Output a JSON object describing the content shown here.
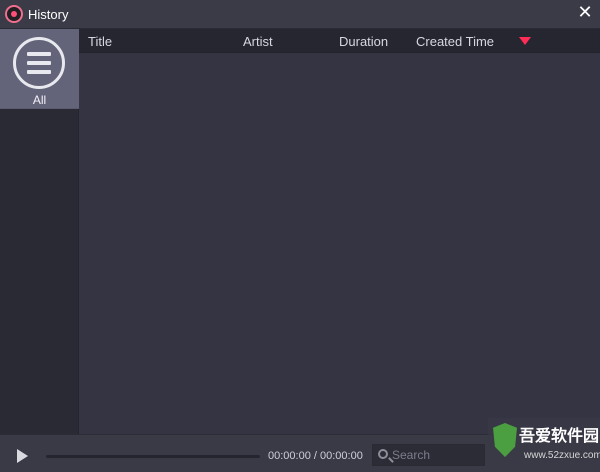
{
  "window": {
    "title": "History",
    "close_symbol": "✕",
    "app_icon": "record-icon"
  },
  "sidebar": {
    "items": [
      {
        "label": "All",
        "icon": "list-icon",
        "selected": true
      }
    ]
  },
  "table": {
    "columns": [
      "Title",
      "Artist",
      "Duration",
      "Created Time"
    ],
    "sort_indicator": "sort-desc-icon",
    "rows": []
  },
  "player": {
    "play_icon": "play-icon",
    "progress_fraction": 0,
    "time": "00:00:00 / 00:00:00"
  },
  "search": {
    "placeholder": "Search",
    "value": ""
  },
  "watermark": {
    "text": "吾爱软件园",
    "url": "www.52zxue.com"
  },
  "colors": {
    "accent": "#ff2d55",
    "titlebar": "#3b3b48",
    "sidebar": "#2a2a34",
    "selected_sidebar_item": "#63637a",
    "header": "#262630",
    "main": "#343442"
  }
}
